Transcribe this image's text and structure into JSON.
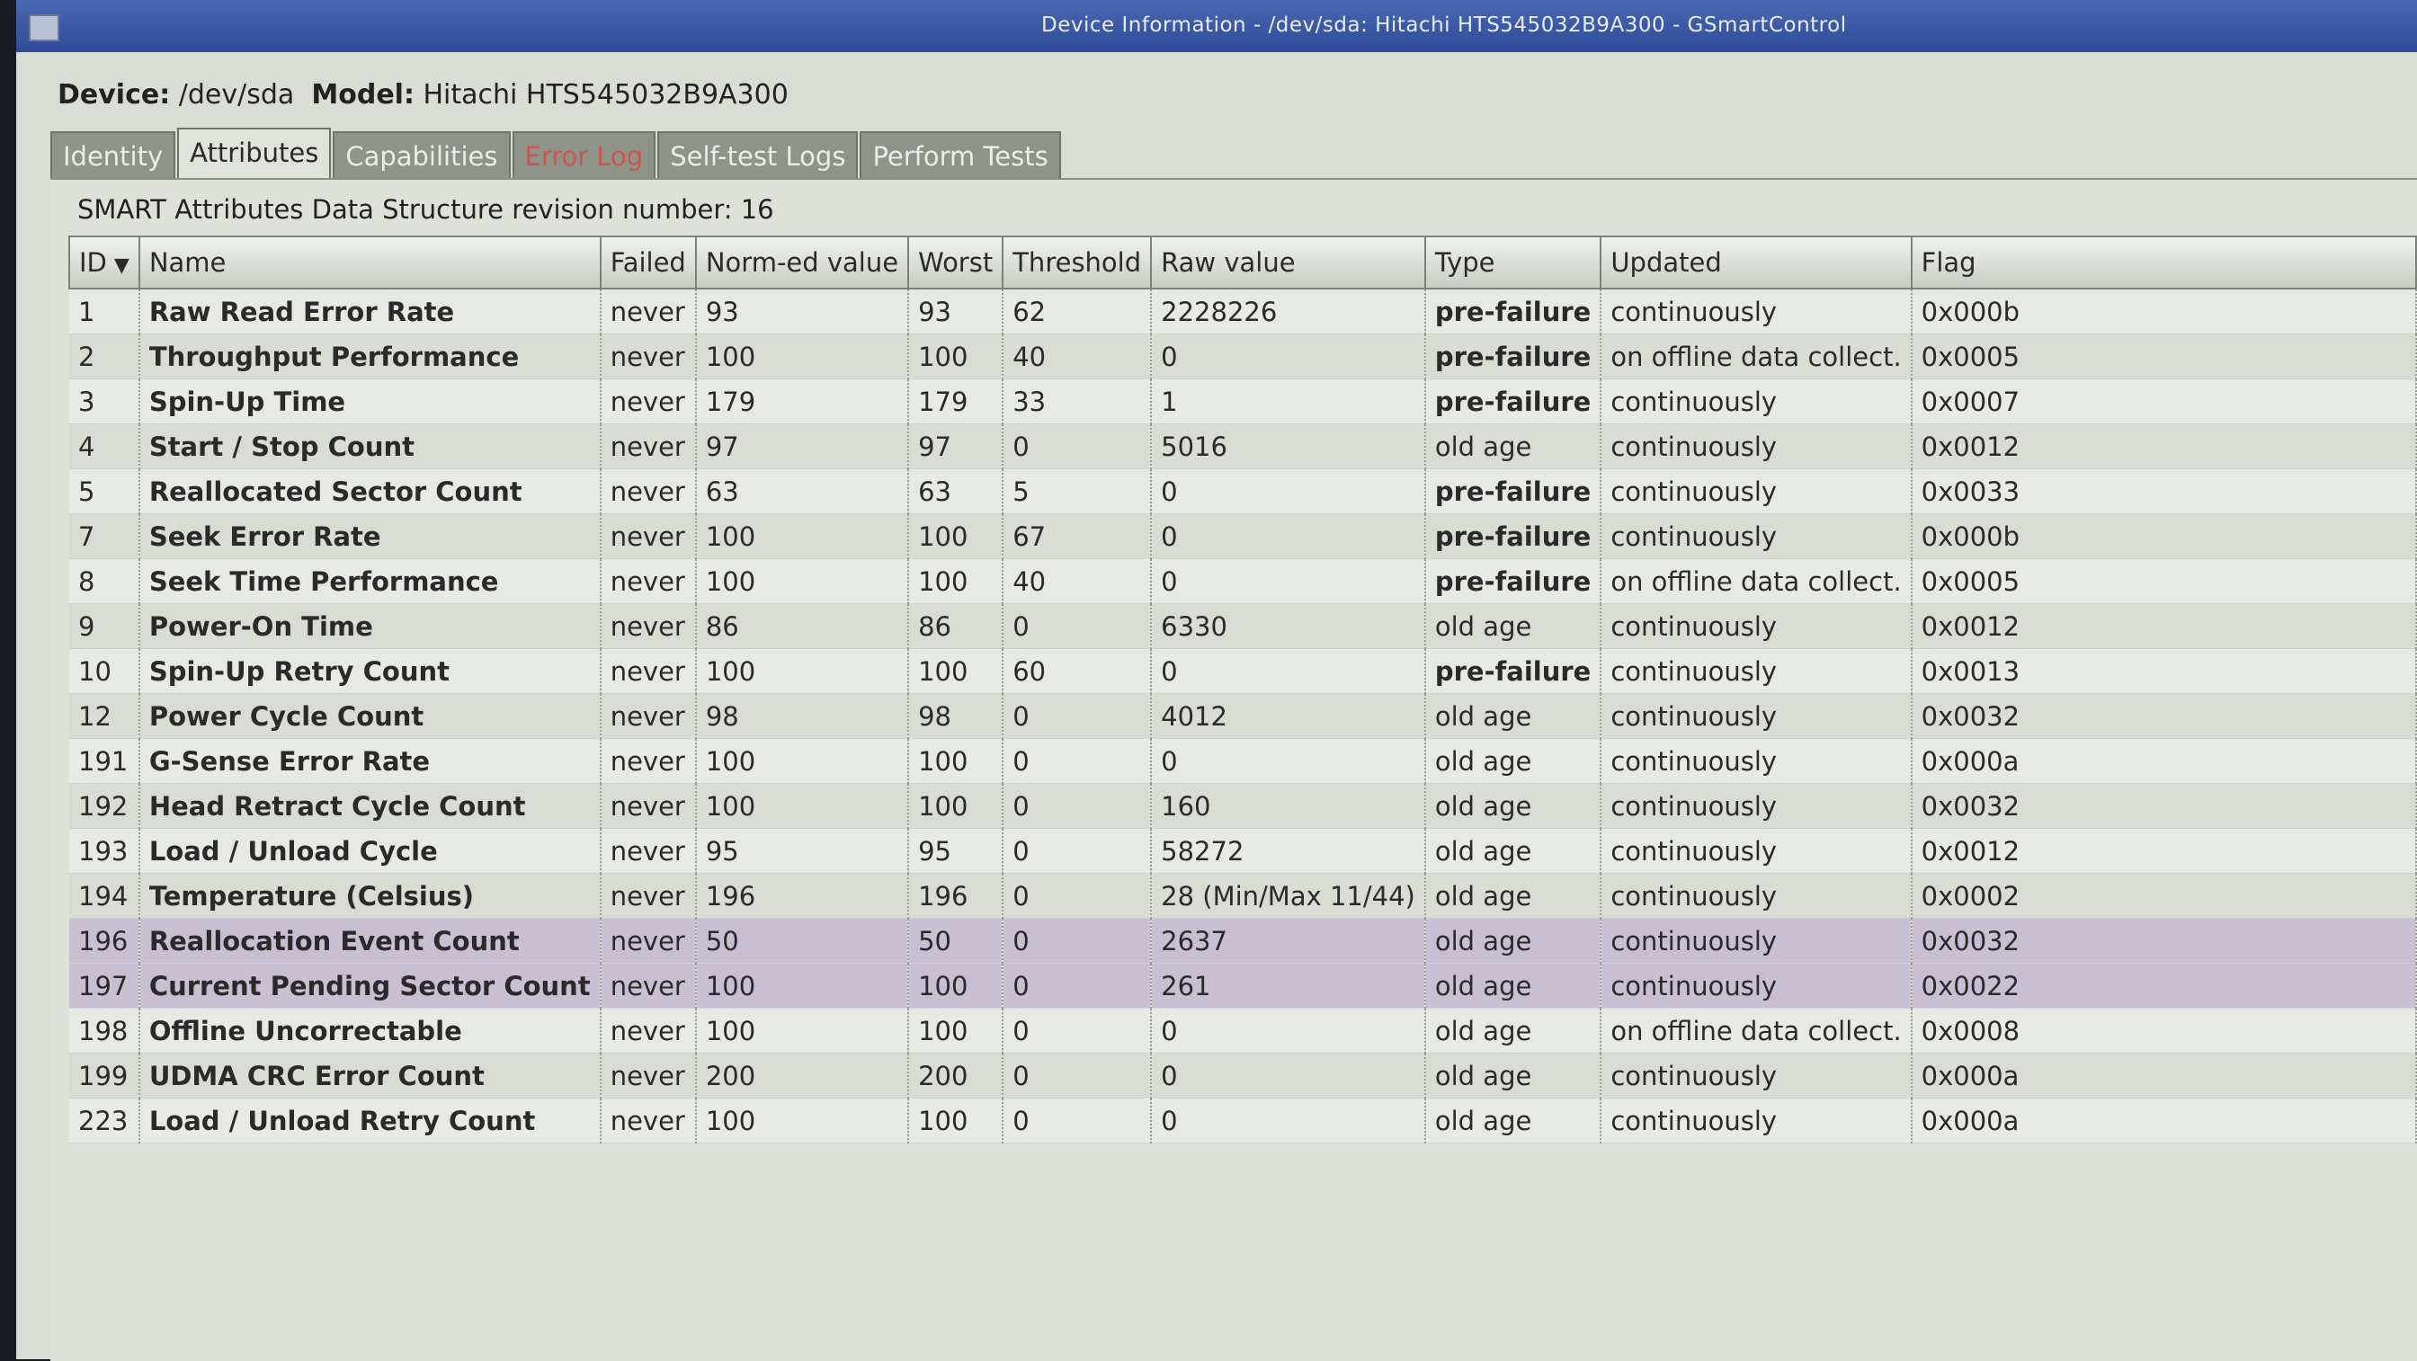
{
  "window": {
    "title": "Device Information - /dev/sda: Hitachi HTS545032B9A300 - GSmartControl"
  },
  "device": {
    "device_label": "Device:",
    "device_value": "/dev/sda",
    "model_label": "Model:",
    "model_value": "Hitachi HTS545032B9A300"
  },
  "tabs": [
    {
      "label": "Identity"
    },
    {
      "label": "Attributes"
    },
    {
      "label": "Capabilities"
    },
    {
      "label": "Error Log"
    },
    {
      "label": "Self-test Logs"
    },
    {
      "label": "Perform Tests"
    }
  ],
  "attributes": {
    "revision_text": "SMART Attributes Data Structure revision number: 16",
    "columns": {
      "id": "ID",
      "name": "Name",
      "failed": "Failed",
      "norm": "Norm-ed value",
      "worst": "Worst",
      "threshold": "Threshold",
      "raw": "Raw value",
      "type": "Type",
      "updated": "Updated",
      "flag": "Flag"
    },
    "sort_icon": "sort-down-arrow",
    "rows": [
      {
        "id": "1",
        "name": "Raw Read Error Rate",
        "failed": "never",
        "norm": "93",
        "worst": "93",
        "threshold": "62",
        "raw": "2228226",
        "type": "pre-failure",
        "updated": "continuously",
        "flag": "0x000b"
      },
      {
        "id": "2",
        "name": "Throughput Performance",
        "failed": "never",
        "norm": "100",
        "worst": "100",
        "threshold": "40",
        "raw": "0",
        "type": "pre-failure",
        "updated": "on offline data collect.",
        "flag": "0x0005"
      },
      {
        "id": "3",
        "name": "Spin-Up Time",
        "failed": "never",
        "norm": "179",
        "worst": "179",
        "threshold": "33",
        "raw": "1",
        "type": "pre-failure",
        "updated": "continuously",
        "flag": "0x0007"
      },
      {
        "id": "4",
        "name": "Start / Stop Count",
        "failed": "never",
        "norm": "97",
        "worst": "97",
        "threshold": "0",
        "raw": "5016",
        "type": "old age",
        "updated": "continuously",
        "flag": "0x0012"
      },
      {
        "id": "5",
        "name": "Reallocated Sector Count",
        "failed": "never",
        "norm": "63",
        "worst": "63",
        "threshold": "5",
        "raw": "0",
        "type": "pre-failure",
        "updated": "continuously",
        "flag": "0x0033"
      },
      {
        "id": "7",
        "name": "Seek Error Rate",
        "failed": "never",
        "norm": "100",
        "worst": "100",
        "threshold": "67",
        "raw": "0",
        "type": "pre-failure",
        "updated": "continuously",
        "flag": "0x000b"
      },
      {
        "id": "8",
        "name": "Seek Time Performance",
        "failed": "never",
        "norm": "100",
        "worst": "100",
        "threshold": "40",
        "raw": "0",
        "type": "pre-failure",
        "updated": "on offline data collect.",
        "flag": "0x0005"
      },
      {
        "id": "9",
        "name": "Power-On Time",
        "failed": "never",
        "norm": "86",
        "worst": "86",
        "threshold": "0",
        "raw": "6330",
        "type": "old age",
        "updated": "continuously",
        "flag": "0x0012"
      },
      {
        "id": "10",
        "name": "Spin-Up Retry Count",
        "failed": "never",
        "norm": "100",
        "worst": "100",
        "threshold": "60",
        "raw": "0",
        "type": "pre-failure",
        "updated": "continuously",
        "flag": "0x0013"
      },
      {
        "id": "12",
        "name": "Power Cycle Count",
        "failed": "never",
        "norm": "98",
        "worst": "98",
        "threshold": "0",
        "raw": "4012",
        "type": "old age",
        "updated": "continuously",
        "flag": "0x0032"
      },
      {
        "id": "191",
        "name": "G-Sense Error Rate",
        "failed": "never",
        "norm": "100",
        "worst": "100",
        "threshold": "0",
        "raw": "0",
        "type": "old age",
        "updated": "continuously",
        "flag": "0x000a"
      },
      {
        "id": "192",
        "name": "Head Retract Cycle Count",
        "failed": "never",
        "norm": "100",
        "worst": "100",
        "threshold": "0",
        "raw": "160",
        "type": "old age",
        "updated": "continuously",
        "flag": "0x0032"
      },
      {
        "id": "193",
        "name": "Load / Unload Cycle",
        "failed": "never",
        "norm": "95",
        "worst": "95",
        "threshold": "0",
        "raw": "58272",
        "type": "old age",
        "updated": "continuously",
        "flag": "0x0012"
      },
      {
        "id": "194",
        "name": "Temperature (Celsius)",
        "failed": "never",
        "norm": "196",
        "worst": "196",
        "threshold": "0",
        "raw": "28 (Min/Max 11/44)",
        "type": "old age",
        "updated": "continuously",
        "flag": "0x0002"
      },
      {
        "id": "196",
        "name": "Reallocation Event Count",
        "failed": "never",
        "norm": "50",
        "worst": "50",
        "threshold": "0",
        "raw": "2637",
        "type": "old age",
        "updated": "continuously",
        "flag": "0x0032"
      },
      {
        "id": "197",
        "name": "Current Pending Sector Count",
        "failed": "never",
        "norm": "100",
        "worst": "100",
        "threshold": "0",
        "raw": "261",
        "type": "old age",
        "updated": "continuously",
        "flag": "0x0022"
      },
      {
        "id": "198",
        "name": "Offline Uncorrectable",
        "failed": "never",
        "norm": "100",
        "worst": "100",
        "threshold": "0",
        "raw": "0",
        "type": "old age",
        "updated": "on offline data collect.",
        "flag": "0x0008"
      },
      {
        "id": "199",
        "name": "UDMA CRC Error Count",
        "failed": "never",
        "norm": "200",
        "worst": "200",
        "threshold": "0",
        "raw": "0",
        "type": "old age",
        "updated": "continuously",
        "flag": "0x000a"
      },
      {
        "id": "223",
        "name": "Load / Unload Retry Count",
        "failed": "never",
        "norm": "100",
        "worst": "100",
        "threshold": "0",
        "raw": "0",
        "type": "old age",
        "updated": "continuously",
        "flag": "0x000a"
      }
    ]
  }
}
